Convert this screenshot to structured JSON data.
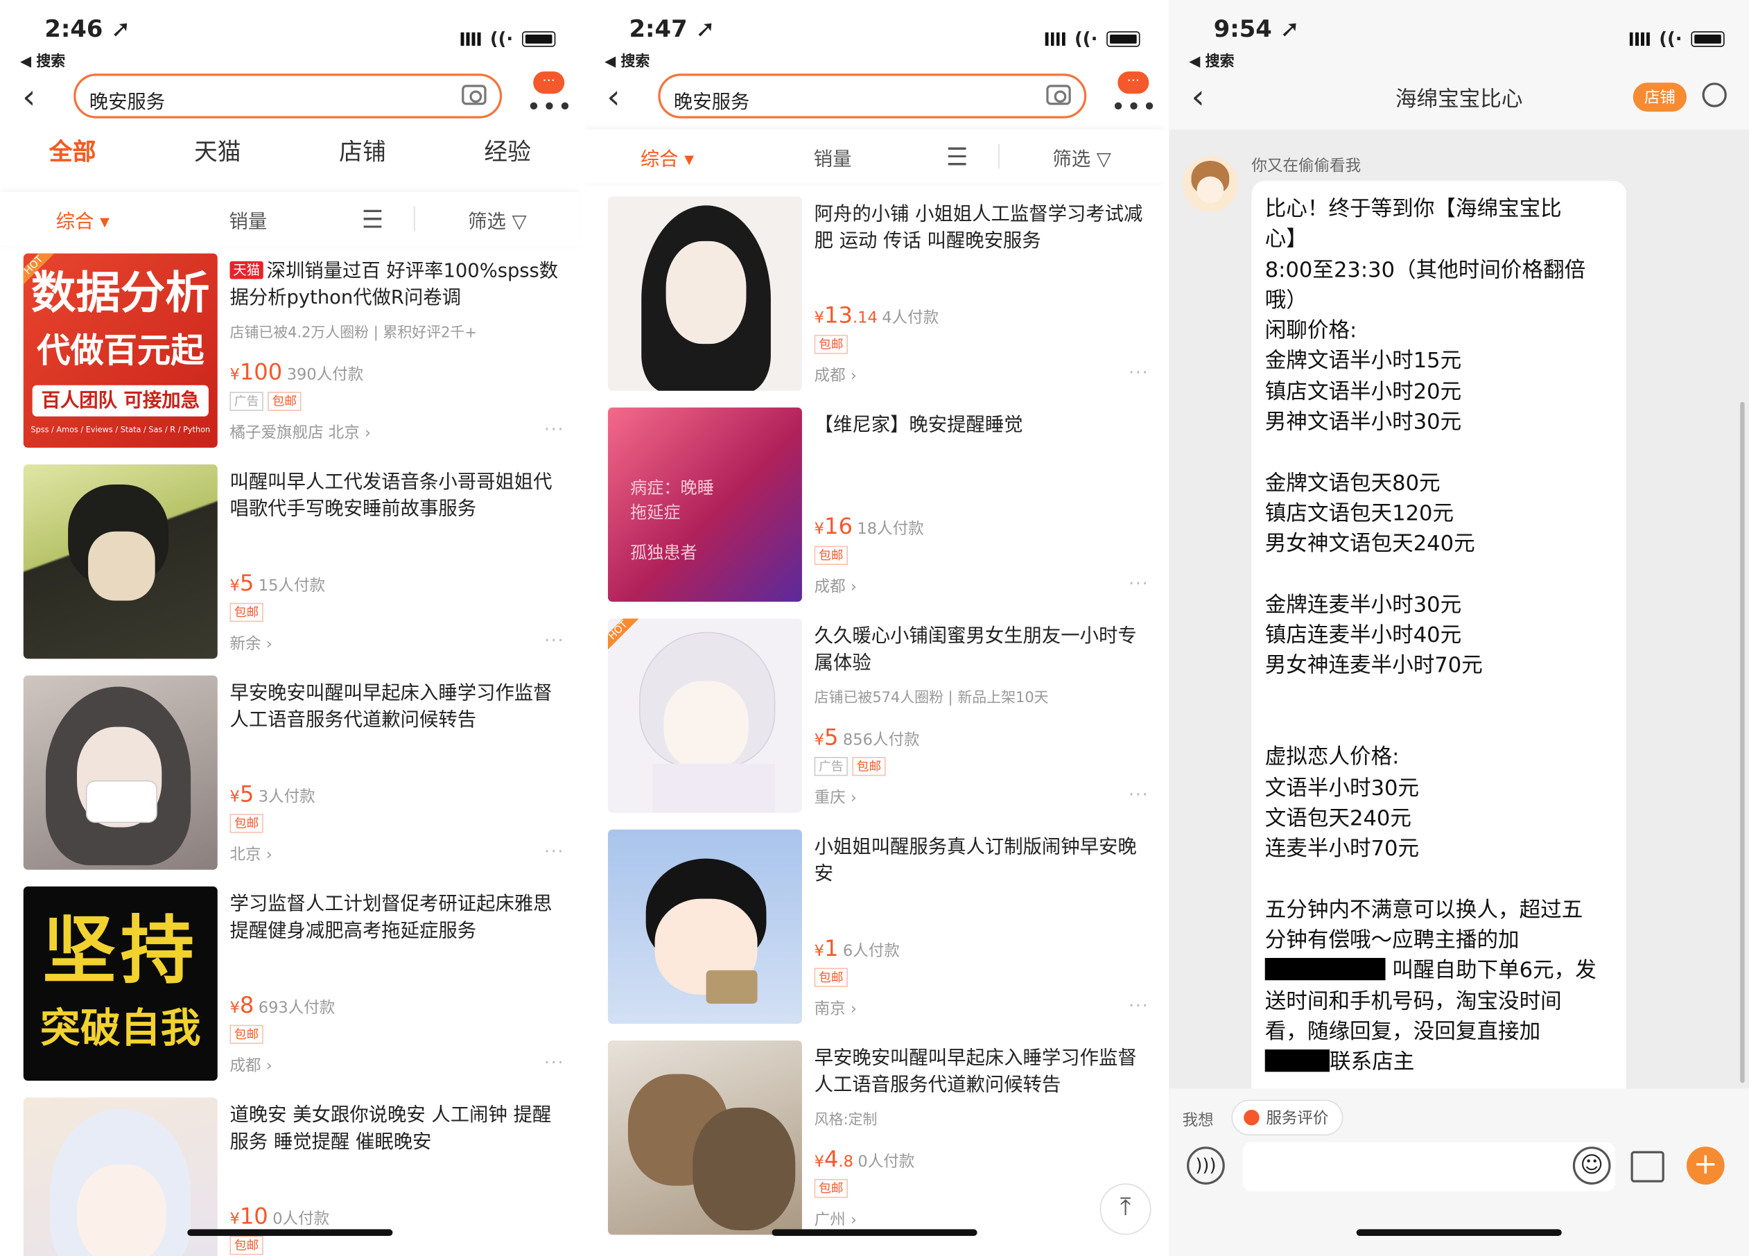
{
  "panel1": {
    "status": {
      "time": "2:46 ➚",
      "back": "◀ 搜索"
    },
    "search": {
      "value": "晚安服务"
    },
    "more_badge": "···",
    "tabs": [
      "全部",
      "天猫",
      "店铺",
      "经验"
    ],
    "sort": {
      "comprehensive": "综合 ▾",
      "sales": "销量",
      "filter": "筛选 ▽"
    },
    "items": [
      {
        "badge": "天猫",
        "title": "深圳销量过百 好评率100%spss数据分析python代做R问卷调",
        "sub": "店铺已被4.2万人圈粉 | 累积好评2千+",
        "currency": "¥",
        "price": "100",
        "paid": "390人付款",
        "tag_ad": "广告",
        "tag_free": "包邮",
        "loc": "橘子爱旗舰店 北京 ›",
        "thumb_text": [
          "数据分析",
          "代做百元起",
          "百人团队 可接加急",
          "Spss / Amos / Eviews / Stata / Sas / R / Python"
        ],
        "hot": "HOT"
      },
      {
        "title": "叫醒叫早人工代发语音条小哥哥姐姐代唱歌代手写晚安睡前故事服务",
        "currency": "¥",
        "price": "5",
        "paid": "15人付款",
        "tag_free": "包邮",
        "loc": "新余 ›"
      },
      {
        "title": "早安晚安叫醒叫早起床入睡学习作监督人工语音服务代道歉问候转告",
        "currency": "¥",
        "price": "5",
        "paid": "3人付款",
        "tag_free": "包邮",
        "loc": "北京 ›"
      },
      {
        "title": "学习监督人工计划督促考研证起床雅思提醒健身减肥高考拖延症服务",
        "currency": "¥",
        "price": "8",
        "paid": "693人付款",
        "tag_free": "包邮",
        "loc": "成都 ›",
        "thumb_text": [
          "坚持",
          "突破自我"
        ]
      },
      {
        "title": "道晚安 美女跟你说晚安 人工闹钟 提醒服务 睡觉提醒 催眠晚安",
        "currency": "¥",
        "price": "10",
        "paid": "0人付款",
        "tag_free": "包邮"
      }
    ]
  },
  "panel2": {
    "status": {
      "time": "2:47 ➚",
      "back": "◀ 搜索"
    },
    "search": {
      "value": "晚安服务"
    },
    "more_badge": "···",
    "sort": {
      "comprehensive": "综合 ▾",
      "sales": "销量",
      "filter": "筛选 ▽"
    },
    "items": [
      {
        "title": "阿舟的小铺 小姐姐人工监督学习考试减肥 运动 传话 叫醒晚安服务",
        "currency": "¥",
        "price": "13",
        "price_dec": ".14",
        "paid": "4人付款",
        "tag_free": "包邮",
        "loc": "成都 ›"
      },
      {
        "title": "【维尼家】晚安提醒睡觉",
        "currency": "¥",
        "price": "16",
        "paid": "18人付款",
        "tag_free": "包邮",
        "loc": "成都 ›",
        "thumb_text": [
          "病症：晚睡",
          "拖延症",
          "孤独患者"
        ]
      },
      {
        "title": "久久暖心小铺闺蜜男女生朋友一小时专属体验",
        "sub": "店铺已被574人圈粉 | 新品上架10天",
        "currency": "¥",
        "price": "5",
        "paid": "856人付款",
        "tag_ad": "广告",
        "tag_free": "包邮",
        "loc": "重庆 ›",
        "hot": "HOT"
      },
      {
        "title": "小姐姐叫醒服务真人订制版闹钟早安晚安",
        "currency": "¥",
        "price": "1",
        "paid": "6人付款",
        "tag_free": "包邮",
        "loc": "南京 ›"
      },
      {
        "title": "早安晚安叫醒叫早起床入睡学习作监督人工语音服务代道歉问候转告",
        "sub": "风格:定制",
        "currency": "¥",
        "price": "4",
        "price_dec": ".8",
        "paid": "0人付款",
        "tag_free": "包邮",
        "loc": "广州 ›"
      }
    ]
  },
  "panel3": {
    "status": {
      "time": "9:54 ➚",
      "back": "◀ 搜索"
    },
    "title": "海绵宝宝比心",
    "shop_btn": "店铺",
    "nickname": "你又在偷偷看我",
    "message_lines": [
      "比心！终于等到你【海绵宝宝比",
      "心】",
      "8:00至23:30（其他时间价格翻倍",
      "哦）",
      "闲聊价格:",
      "金牌文语半小时15元",
      "镇店文语半小时20元",
      "男神文语半小时30元",
      "",
      "金牌文语包天80元",
      "镇店文语包天120元",
      "男女神文语包天240元",
      "",
      "金牌连麦半小时30元",
      "镇店连麦半小时40元",
      "男女神连麦半小时70元",
      "",
      "",
      "虚拟恋人价格:",
      "文语半小时30元",
      "文语包天240元",
      "连麦半小时70元",
      "",
      "五分钟内不满意可以换人，超过五",
      "分钟有偿哦～应聘主播的加"
    ],
    "message_tail": {
      "l1": " 叫醒自助下单6元，发",
      "l2": "送时间和手机号码，淘宝没时间",
      "l3": "看，随缘回复，没回复直接加",
      "l4": "联系店主"
    },
    "wish": "我想",
    "service_review": "服务评价"
  }
}
